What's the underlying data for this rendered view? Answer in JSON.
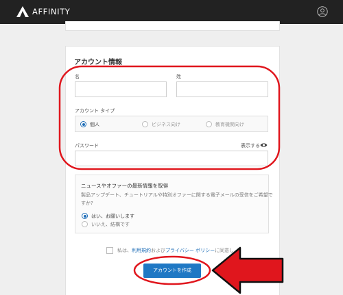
{
  "header": {
    "brand": "AFFINITY",
    "user_icon": "user-circle-icon",
    "logo_icon": "affinity-logo-icon"
  },
  "form": {
    "title": "アカウント情報",
    "first_name_label": "名",
    "last_name_label": "姓",
    "account_type_label": "アカウント タイプ",
    "account_types": [
      {
        "label": "個人",
        "selected": true
      },
      {
        "label": "ビジネス向け",
        "selected": false
      },
      {
        "label": "教育機関向け",
        "selected": false
      }
    ],
    "password_label": "パスワード",
    "show_password_label": "表示する"
  },
  "newsletter": {
    "heading": "ニュースやオファーの最新情報を取得",
    "question_line1": "製品アップデート、チュートリアルや特別オファーに関する電子メールの受信をご希望で",
    "question_line2": "すか?",
    "options": [
      {
        "label": "はい、お願いします",
        "selected": true
      },
      {
        "label": "いいえ、結構です",
        "selected": false
      }
    ]
  },
  "agreement": {
    "prefix": "私は、",
    "terms_link": "利用規約",
    "middle": "および",
    "privacy_link": "プライバシー ポリシー",
    "suffix": "に同意し..."
  },
  "submit": {
    "label": "アカウントを作成"
  },
  "colors": {
    "accent": "#1f78c4",
    "annotation_red": "#e0161d",
    "topbar": "#222222"
  }
}
